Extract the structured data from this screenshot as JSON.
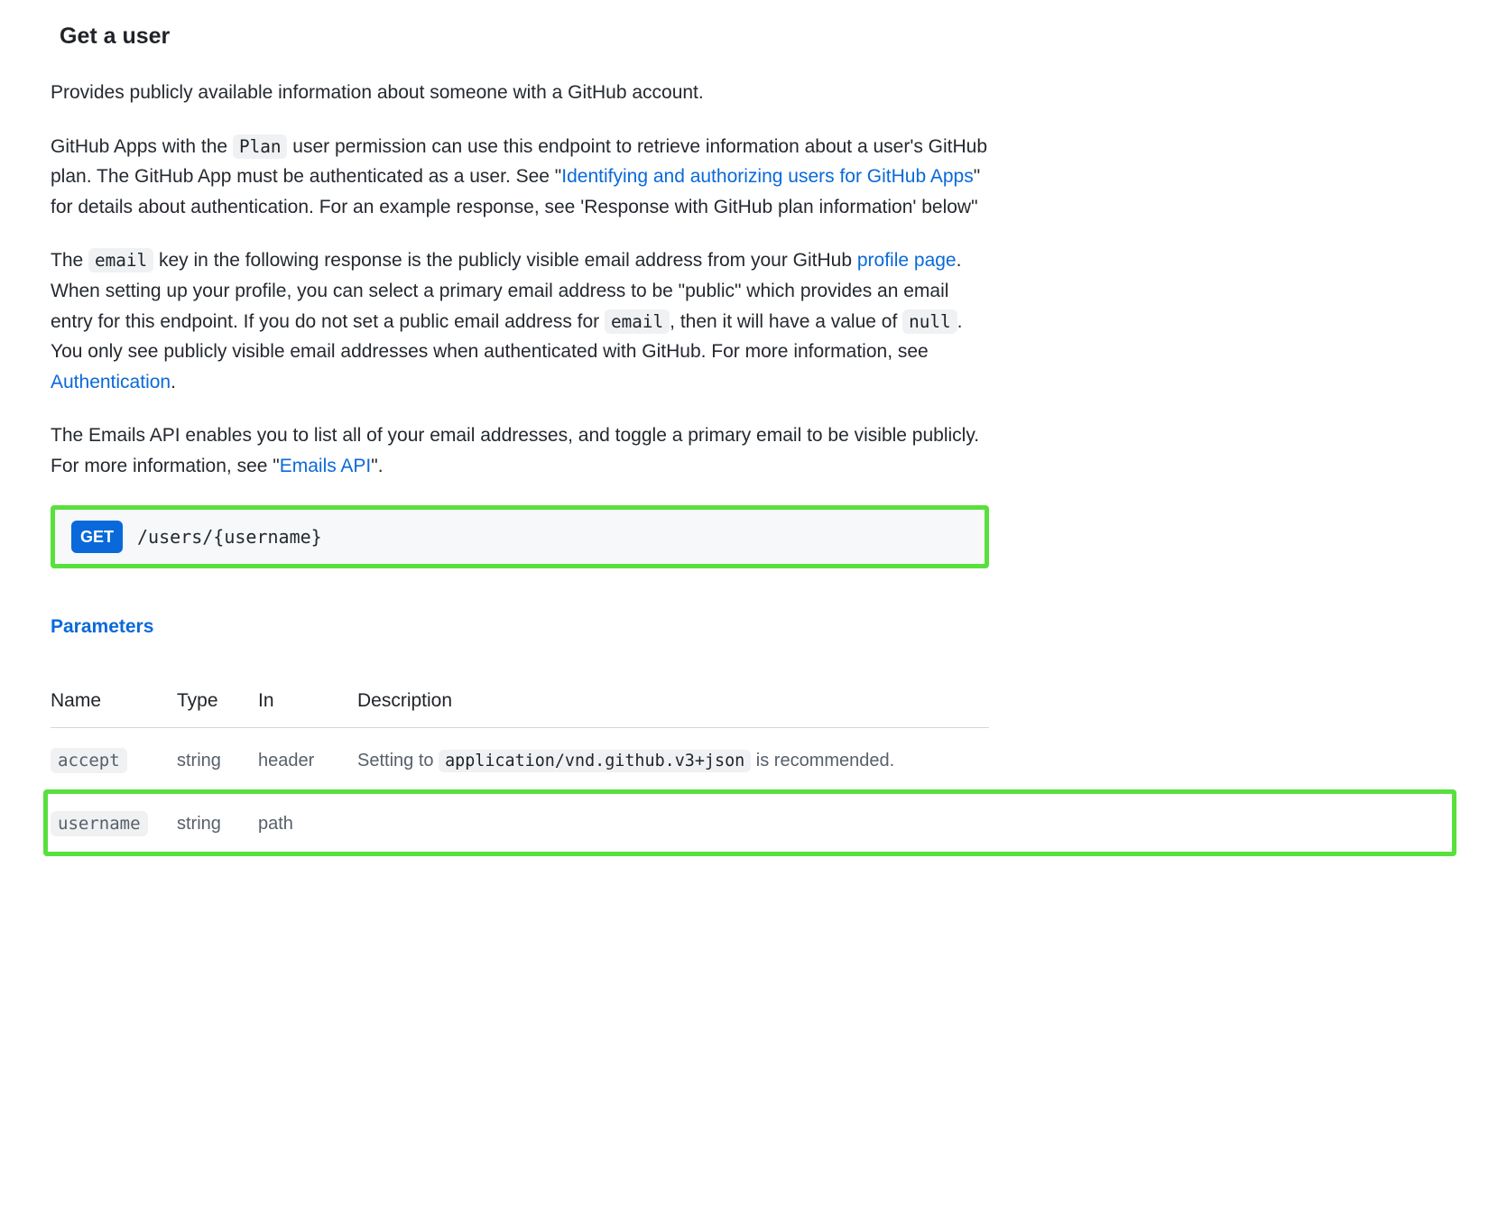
{
  "title": "Get a user",
  "para1": "Provides publicly available information about someone with a GitHub account.",
  "para2": {
    "pre": "GitHub Apps with the ",
    "code1": "Plan",
    "mid1": " user permission can use this endpoint to retrieve information about a user's GitHub plan. The GitHub App must be authenticated as a user. See \"",
    "link1": "Identifying and authorizing users for GitHub Apps",
    "post1": "\" for details about authentication. For an example response, see 'Response with GitHub plan information' below\""
  },
  "para3": {
    "pre": "The ",
    "code1": "email",
    "mid1": " key in the following response is the publicly visible email address from your GitHub ",
    "link1": "profile page",
    "mid2": ". When setting up your profile, you can select a primary email address to be \"public\" which provides an email entry for this endpoint. If you do not set a public email address for ",
    "code2": "email",
    "mid3": ", then it will have a value of ",
    "code3": "null",
    "mid4": ". You only see publicly visible email addresses when authenticated with GitHub. For more information, see ",
    "link2": "Authentication",
    "post": "."
  },
  "para4": {
    "pre": "The Emails API enables you to list all of your email addresses, and toggle a primary email to be visible publicly. For more information, see \"",
    "link1": "Emails API",
    "post": "\"."
  },
  "endpoint": {
    "method": "GET",
    "path": "/users/{username}"
  },
  "parameters_heading": "Parameters",
  "table": {
    "headers": {
      "name": "Name",
      "type": "Type",
      "in": "In",
      "description": "Description"
    },
    "rows": [
      {
        "name": "accept",
        "type": "string",
        "in": "header",
        "desc_pre": "Setting to ",
        "desc_code": "application/vnd.github.v3+json",
        "desc_post": " is recommended."
      },
      {
        "name": "username",
        "type": "string",
        "in": "path",
        "desc_pre": "",
        "desc_code": "",
        "desc_post": ""
      }
    ]
  }
}
